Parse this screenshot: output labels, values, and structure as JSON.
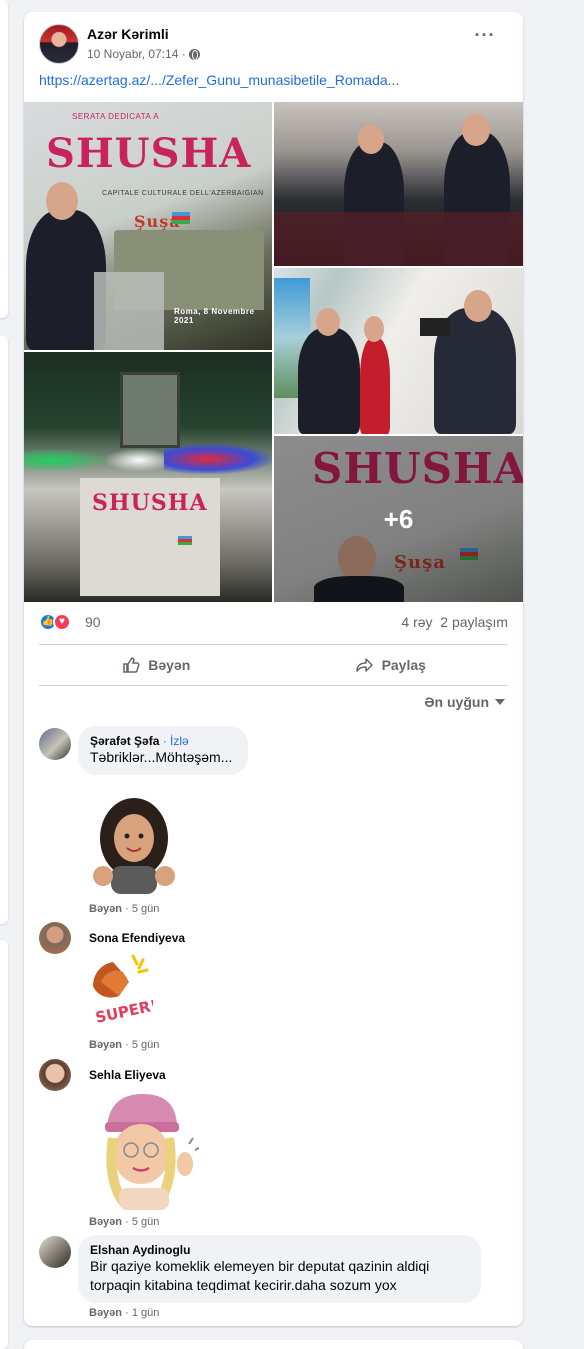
{
  "post": {
    "author": "Azər Kərimli",
    "date": "10 Noyabr, 07:14 ·",
    "link": "https://azertag.az/.../Zefer_Gunu_munasibetile_Romada...",
    "more_icon": "···",
    "photos": {
      "overlay_count": "+6",
      "banner_title": "SHUSHA",
      "banner_subtitle": "CAPITALE CULTURALE DELL'AZERBAIGIAN",
      "banner_top": "SERATA DEDICATA A",
      "banner_word": "Şuşa",
      "banner_date": "Roma, 8 Novembre 2021"
    },
    "reactions": {
      "count": "90",
      "comments": "4 rəy",
      "shares": "2 paylaşım"
    },
    "actions": {
      "like": "Bəyən",
      "share": "Paylaş"
    },
    "sort_label": "Ən uyğun"
  },
  "comments": [
    {
      "name": "Şərafət Şəfa",
      "follow": "· İzlə",
      "text": "Təbriklər...Möhtəşəm...",
      "footer_like": "Bəyən",
      "footer_time": "· 5 gün",
      "sticker": "avatar-thumbs-up"
    },
    {
      "name": "Sona Efendiyeva",
      "text": "",
      "footer_like": "Bəyən",
      "footer_time": "· 5 gün",
      "sticker": "clapping-super"
    },
    {
      "name": "Sehla Eliyeva",
      "text": "",
      "footer_like": "Bəyən",
      "footer_time": "· 5 gün",
      "sticker": "avatar-waving"
    },
    {
      "name": "Elshan Aydinoglu",
      "text": "Bir qaziye komeklik elemeyen bir deputat qazinin aldiqi torpaqin kitabina teqdimat kecirir.daha sozum yox",
      "footer_like": "Bəyən",
      "footer_time": "· 1 gün"
    }
  ],
  "colors": {
    "link": "#216fdb",
    "like_blue": "#1877f2",
    "love_red": "#f33e58",
    "muted": "#65676b",
    "banner_pink": "#c8235c"
  }
}
